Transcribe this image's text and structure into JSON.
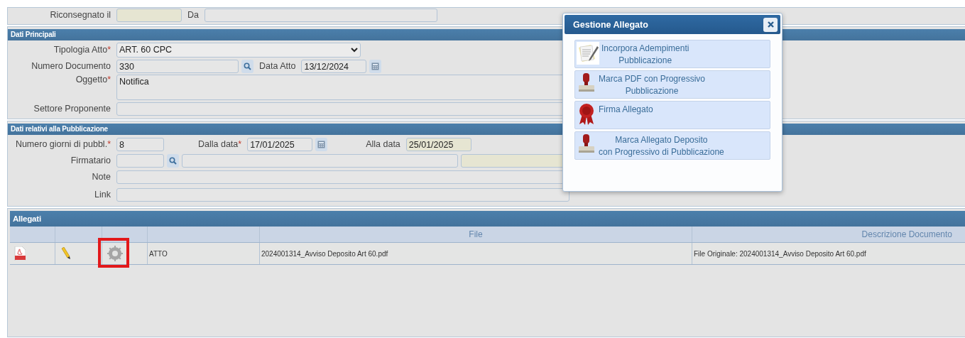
{
  "riconsegna": {
    "label": "Riconsegnato il",
    "readonly": true,
    "da_label": "Da"
  },
  "dati_principali": {
    "title": "Dati Principali",
    "tipologia": {
      "label": "Tipologia Atto",
      "required_mark": "*",
      "value": "ART. 60 CPC"
    },
    "numero_documento": {
      "label": "Numero Documento",
      "value": "330"
    },
    "data_atto": {
      "label": "Data Atto",
      "value": "13/12/2024"
    },
    "oggetto": {
      "label": "Oggetto",
      "required_mark": "*",
      "value": "Notifica"
    },
    "settore": {
      "label": "Settore Proponente"
    }
  },
  "pubblicazione": {
    "title": "Dati relativi alla Pubblicazione",
    "giorni": {
      "label": "Numero giorni di pubbl.",
      "required_mark": "*",
      "value": "8"
    },
    "dalla_data": {
      "label": "Dalla data",
      "required_mark": "*",
      "value": "17/01/2025"
    },
    "alla_data": {
      "label": "Alla data",
      "value": "25/01/2025",
      "readonly": true
    },
    "firmatario": {
      "label": "Firmatario",
      "readonly": true
    },
    "note": {
      "label": "Note"
    },
    "link": {
      "label": "Link"
    }
  },
  "allegati": {
    "title": "Allegati",
    "columns": [
      "File",
      "Descrizione Documento"
    ],
    "rows": [
      {
        "type": "ATTO",
        "file": "2024001314_Avviso Deposito Art 60.pdf",
        "descrizione": "File Originale: 2024001314_Avviso Deposito Art 60.pdf",
        "gear_highlighted": true
      }
    ]
  },
  "dialog": {
    "title": "Gestione Allegato",
    "items": [
      {
        "kind": "document",
        "text": "Incorpora Adempimenti\nPubblicazione"
      },
      {
        "kind": "stamp",
        "text": "Marca PDF con Progressivo\nPubblicazione"
      },
      {
        "kind": "seal",
        "text": "Firma Allegato"
      },
      {
        "kind": "stamp",
        "text": "Marca Allegato Deposito\ncon Progressivo di Pubblicazione"
      }
    ]
  }
}
